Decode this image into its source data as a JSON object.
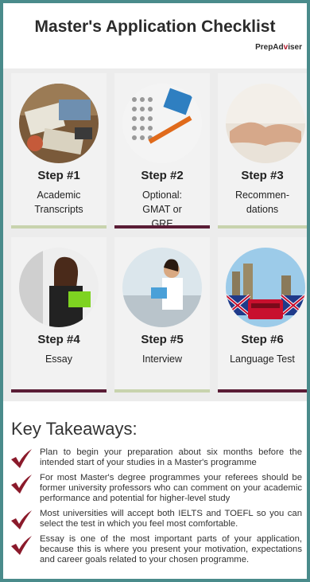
{
  "header": {
    "title": "Master's Application Checklist",
    "brand_main": "PrepAd",
    "brand_accent": "v",
    "brand_end": "iser"
  },
  "steps": [
    {
      "step": "Step #1",
      "desc": "Academic Transcripts",
      "bar_color": "#c8d3ae"
    },
    {
      "step": "Step #2",
      "desc": "Optional: GMAT or GRE",
      "bar_color": "#5a1d36"
    },
    {
      "step": "Step #3",
      "desc": "Recommen-dations",
      "bar_color": "#c8d3ae"
    },
    {
      "step": "Step #4",
      "desc": "Essay",
      "bar_color": "#5a1d36"
    },
    {
      "step": "Step #5",
      "desc": "Interview",
      "bar_color": "#c8d3ae"
    },
    {
      "step": "Step #6",
      "desc": "Language Test",
      "bar_color": "#5a1d36"
    }
  ],
  "takeaways": {
    "title": "Key Takeaways:",
    "items": [
      "Plan to begin your preparation about six months before the intended start of your studies in a Master's programme",
      "For most Master's degree programmes your referees should be former university professors who can comment on your academic performance and potential for higher-level study",
      "Most universities will accept both IELTS and TOEFL so you can select the test in which you feel most comfortable.",
      "Essay is one of the most important parts of your application, because this is where you present your motivation, expectations and career goals related to your chosen programme."
    ]
  },
  "colors": {
    "check": "#8b1a2b",
    "bar_light": "#c8d3ae",
    "bar_dark": "#5a1d36"
  }
}
